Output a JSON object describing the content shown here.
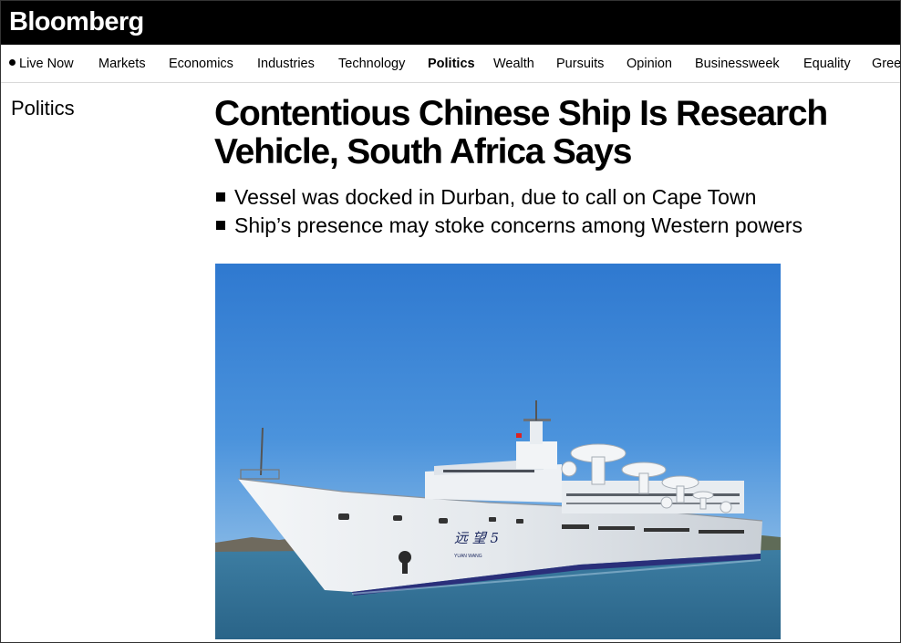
{
  "brand": {
    "logo": "Bloomberg"
  },
  "nav": {
    "items": [
      {
        "label": "Live Now"
      },
      {
        "label": "Markets"
      },
      {
        "label": "Economics"
      },
      {
        "label": "Industries"
      },
      {
        "label": "Technology"
      },
      {
        "label": "Politics",
        "active": true
      },
      {
        "label": "Wealth"
      },
      {
        "label": "Pursuits"
      },
      {
        "label": "Opinion"
      },
      {
        "label": "Businessweek"
      },
      {
        "label": "Equality"
      },
      {
        "label": "Gree"
      }
    ]
  },
  "section": {
    "label": "Politics"
  },
  "article": {
    "headline": "Contentious Chinese Ship Is Research Vehicle, South Africa Says",
    "bullets": [
      "Vessel was docked in Durban, due to call on Cape Town",
      "Ship’s presence may stoke concerns among Western powers"
    ],
    "photo": {
      "hull_markings": {
        "characters": "远 望 5",
        "latin": "YUAN  WANG"
      }
    }
  },
  "colors": {
    "topbar": "#000000",
    "sky": "#3a86d8",
    "sea": "#2f6f97",
    "hull": "#e9ecef"
  }
}
